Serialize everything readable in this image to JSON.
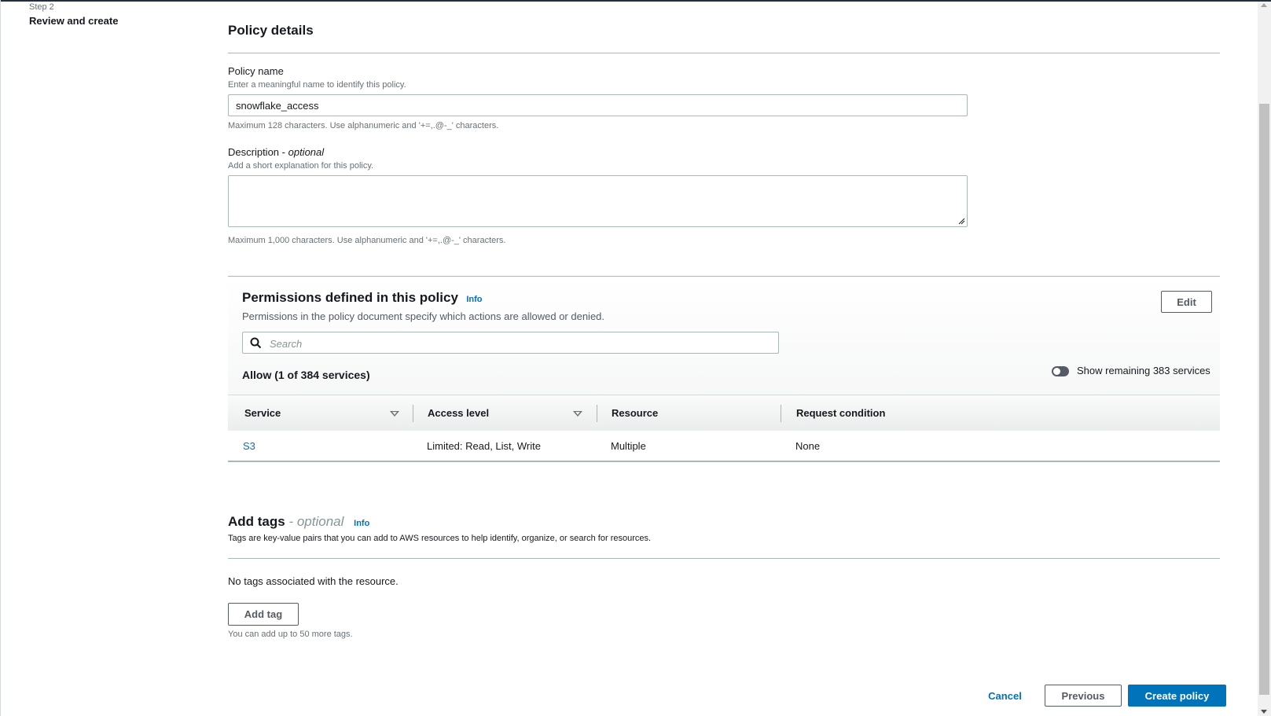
{
  "steps": {
    "label": "Step 2",
    "title": "Review and create"
  },
  "policy_details": {
    "heading": "Policy details",
    "name_label": "Policy name",
    "name_hint": "Enter a meaningful name to identify this policy.",
    "name_value": "snowflake_access",
    "name_constraint": "Maximum 128 characters. Use alphanumeric and '+=,.@-_' characters.",
    "description_label": "Description",
    "description_optional": "optional",
    "description_hint": "Add a short explanation for this policy.",
    "description_value": "",
    "description_constraint": "Maximum 1,000 characters. Use alphanumeric and '+=,.@-_' characters."
  },
  "permissions": {
    "title": "Permissions defined in this policy",
    "info": "Info",
    "subtitle": "Permissions in the policy document specify which actions are allowed or denied.",
    "edit_label": "Edit",
    "search_placeholder": "Search",
    "allow_summary": "Allow (1 of 384 services)",
    "toggle_label": "Show remaining 383 services",
    "columns": [
      "Service",
      "Access level",
      "Resource",
      "Request condition"
    ],
    "rows": [
      {
        "service": "S3",
        "access_level": "Limited: Read, List, Write",
        "resource": "Multiple",
        "request_condition": "None"
      }
    ]
  },
  "tags": {
    "title": "Add tags",
    "optional": "- optional",
    "info": "Info",
    "description": "Tags are key-value pairs that you can add to AWS resources to help identify, organize, or search for resources.",
    "empty_text": "No tags associated with the resource.",
    "add_label": "Add tag",
    "limit_hint": "You can add up to 50 more tags."
  },
  "footer": {
    "cancel_label": "Cancel",
    "previous_label": "Previous",
    "create_label": "Create policy"
  },
  "colors": {
    "primary": "#0073bb",
    "link": "#0073bb",
    "border": "#aab7b8",
    "text": "#16191f",
    "muted": "#687078"
  },
  "icons": [
    "search-icon",
    "sort-icon",
    "toggle-switch",
    "resize-handle-icon"
  ]
}
